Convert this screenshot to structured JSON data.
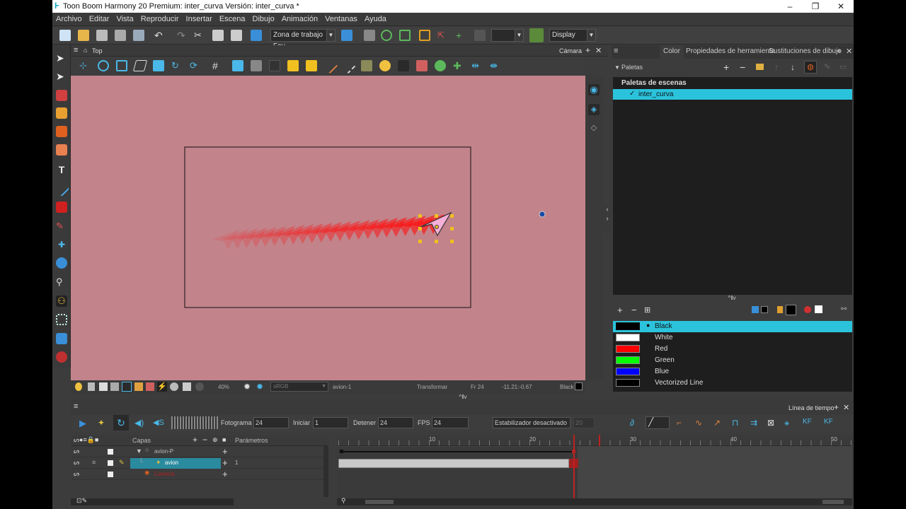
{
  "window": {
    "title": "Toon Boom Harmony 20 Premium: inter_curva Versión: inter_curva *",
    "minimize": "–",
    "maximize": "❐",
    "close": "✕"
  },
  "menu": [
    "Archivo",
    "Editar",
    "Vista",
    "Reproducir",
    "Insertar",
    "Escena",
    "Dibujo",
    "Animación",
    "Ventanas",
    "Ayuda"
  ],
  "toolbar": {
    "workspace": "Zona de trabajo Fav",
    "display": "Display"
  },
  "camera": {
    "breadcrumb": "Top",
    "tab_label": "Cámara"
  },
  "camera_status": {
    "zoom": "40%",
    "colorspace": "sRGB",
    "layer": "avion-1",
    "mode": "Transformar",
    "frame": "Fr 24",
    "coords": "-11.21:-0.67",
    "color": "Black"
  },
  "right_panel": {
    "tabs": [
      "Color",
      "Propiedades de herramienta",
      "Sustituciones de dibujo"
    ],
    "palettes_label": "Paletas",
    "scene_palettes_label": "Paletas de escenas",
    "palette_item": "inter_curva",
    "colors": [
      {
        "name": "Black",
        "hex": "#000000"
      },
      {
        "name": "White",
        "hex": "#ffffff"
      },
      {
        "name": "Red",
        "hex": "#ff0000"
      },
      {
        "name": "Green",
        "hex": "#00ff00"
      },
      {
        "name": "Blue",
        "hex": "#0000ff"
      },
      {
        "name": "Vectorized Line",
        "hex": "#000000"
      }
    ]
  },
  "timeline": {
    "tab_label": "Línea de tiempo",
    "frame_label": "Fotograma",
    "frame_value": "24",
    "start_label": "Iniciar",
    "start_value": "1",
    "stop_label": "Detener",
    "stop_value": "24",
    "fps_label": "FPS",
    "fps_value": "24",
    "stabilizer": "Estabilizador desactivado",
    "stabilizer_value": "20",
    "layers_header": "Capas",
    "params_header": "Parámetros",
    "layers": [
      {
        "name": "avion-P",
        "param": ""
      },
      {
        "name": "avion",
        "param": "1"
      },
      {
        "name": "Camera",
        "param": ""
      }
    ],
    "ruler_ticks": [
      "10",
      "20",
      "30",
      "40",
      "50"
    ]
  }
}
